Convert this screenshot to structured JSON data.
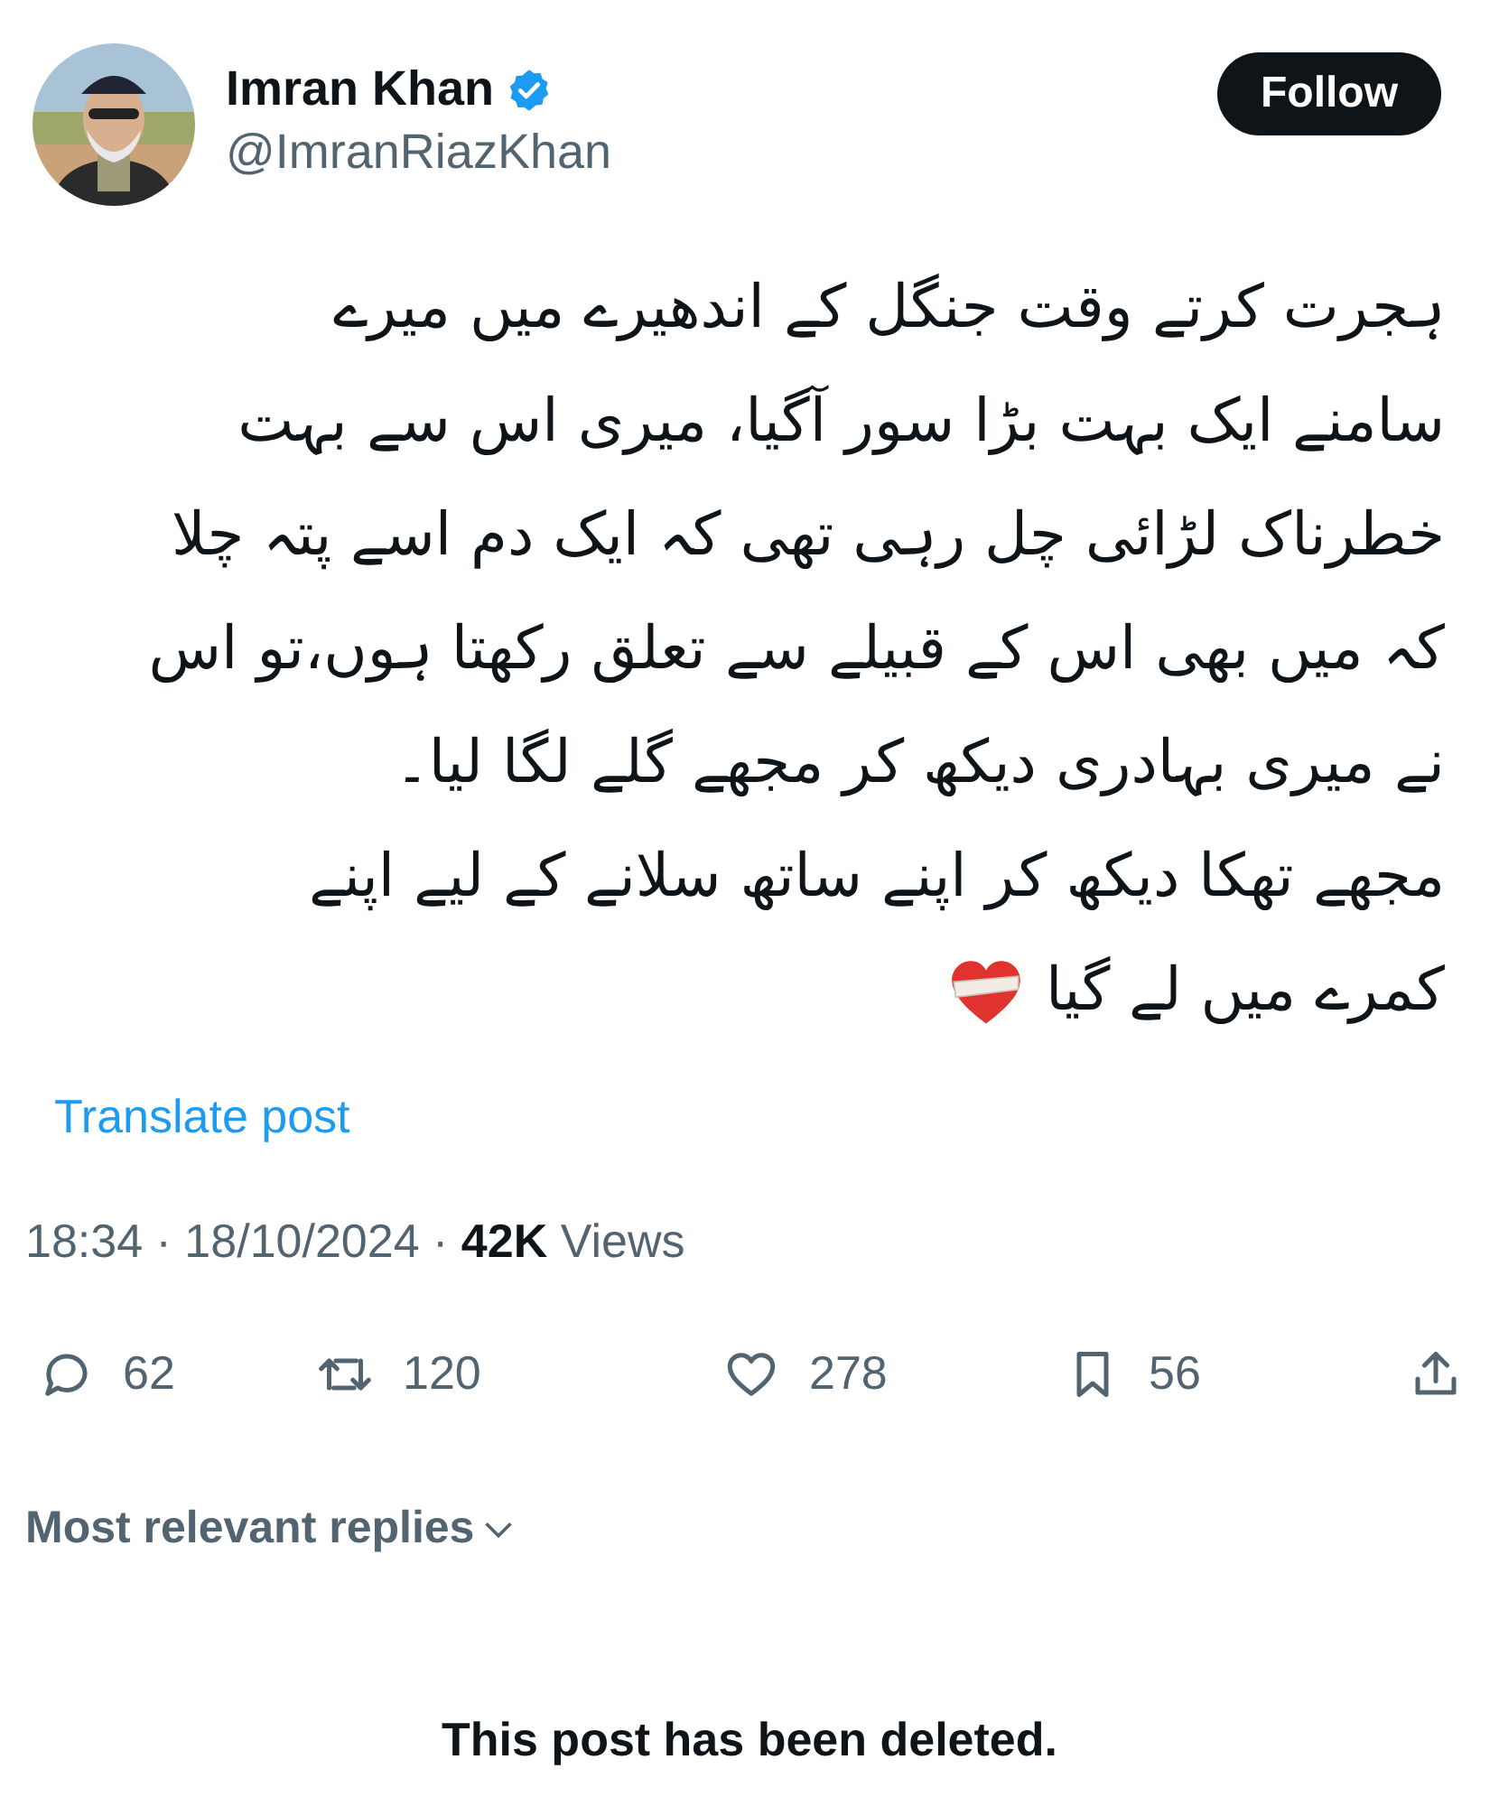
{
  "author": {
    "name": "Imran Khan",
    "verified": true,
    "handle": "@ImranRiazKhan"
  },
  "follow_button": "Follow",
  "post": {
    "lines": [
      "ہجرت کرتے وقت جنگل کے اندھیرے میں میرے",
      "سامنے ایک بہت بڑا سور آگیا، میری اس سے بہت",
      "خطرناک لڑائی چل رہی تھی کہ ایک دم اسے پتہ چلا",
      "کہ میں بھی اس کے قبیلے سے تعلق رکھتا ہوں،تو اس",
      "نے میری بہادری دیکھ کر مجھے گلے لگا لیا۔",
      "مجھے تھکا دیکھ کر اپنے ساتھ سلانے کے لیے اپنے",
      "کمرے میں لے گیا"
    ],
    "ends_with_heart": true
  },
  "translate_link": "Translate post",
  "meta": "18:34 · 18/10/2024 · **42K** Views",
  "actions": {
    "reply": {
      "count": "62"
    },
    "repost": {
      "count": "120"
    },
    "like": {
      "count": "278"
    },
    "bookmark": {
      "count": "56"
    }
  },
  "replies_sort": "Most relevant replies",
  "deleted_notice": "This post has been deleted."
}
